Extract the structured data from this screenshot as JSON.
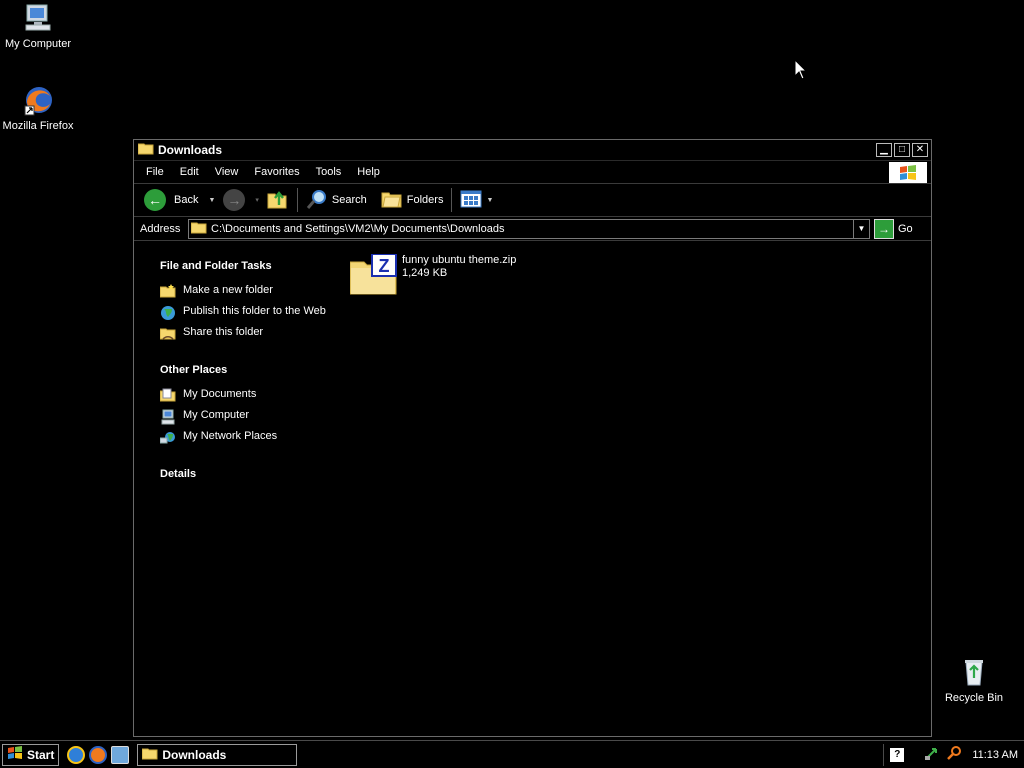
{
  "desktop": {
    "icons": [
      {
        "label": "My Computer"
      },
      {
        "label": "Mozilla Firefox"
      },
      {
        "label": "Recycle Bin"
      }
    ]
  },
  "window": {
    "title": "Downloads",
    "menu": [
      "File",
      "Edit",
      "View",
      "Favorites",
      "Tools",
      "Help"
    ],
    "toolbar": {
      "back_label": "Back",
      "search_label": "Search",
      "folders_label": "Folders"
    },
    "address": {
      "label": "Address",
      "value": "C:\\Documents and Settings\\VM2\\My Documents\\Downloads",
      "go_label": "Go"
    },
    "tasks": {
      "file_folder_title": "File and Folder Tasks",
      "file_folder_items": [
        {
          "label": "Make a new folder"
        },
        {
          "label": "Publish this folder to the Web"
        },
        {
          "label": "Share this folder"
        }
      ],
      "other_places_title": "Other Places",
      "other_places_items": [
        {
          "label": "My Documents"
        },
        {
          "label": "My Computer"
        },
        {
          "label": "My Network Places"
        }
      ],
      "details_title": "Details"
    },
    "files": [
      {
        "name": "funny ubuntu theme.zip",
        "size": "1,249 KB"
      }
    ]
  },
  "taskbar": {
    "start_label": "Start",
    "task_button_label": "Downloads",
    "clock": "11:13 AM"
  }
}
